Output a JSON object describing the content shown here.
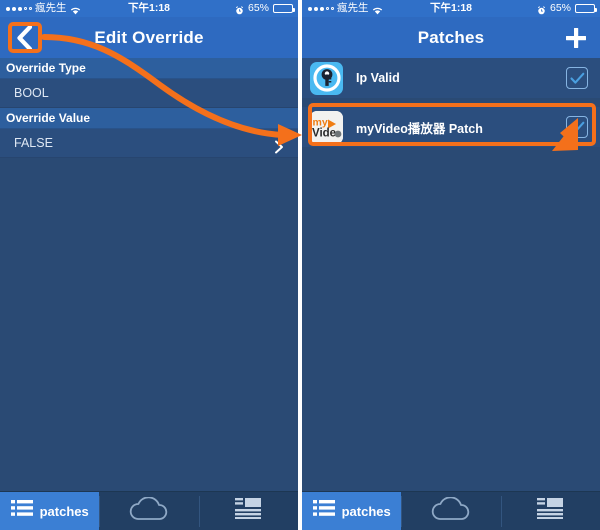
{
  "colors": {
    "navbar": "#2e6ac0",
    "statusbar": "#3070c8",
    "section_header": "#2d5f9e",
    "row": "#2b4e7e",
    "page_bg": "#2a4a74",
    "tabbar": "#223f63",
    "tab_active": "#3b7fd4",
    "annotation": "#f4701b",
    "checkbox_border": "#86b4e2",
    "checkbox_check": "#4a9fe0"
  },
  "status_bar": {
    "signal_filled": 3,
    "signal_empty": 2,
    "carrier": "瘋先生",
    "wifi_icon": "wifi-icon",
    "time": "下午1:18",
    "alarm_icon": "alarm-clock-icon",
    "battery_percent": "65%",
    "battery_level": 65
  },
  "left_screen": {
    "nav": {
      "back_icon": "chevron-left-icon",
      "title": "Edit Override"
    },
    "sections": [
      {
        "header": "Override Type",
        "value": "BOOL",
        "has_chevron": false
      },
      {
        "header": "Override Value",
        "value": "FALSE",
        "has_chevron": true,
        "chevron_icon": "chevron-right-icon"
      }
    ]
  },
  "right_screen": {
    "nav": {
      "title": "Patches",
      "add_icon": "plus-icon"
    },
    "patches": [
      {
        "icon": "key-lock-app-icon",
        "icon_text": "",
        "label": "Ip Valid",
        "checked": true,
        "highlighted": false
      },
      {
        "icon": "myvideo-app-icon",
        "icon_text_top": "my",
        "icon_text_bottom": "Video",
        "label": "myVideo播放器 Patch",
        "checked": true,
        "highlighted": true
      }
    ]
  },
  "tab_bar": {
    "tabs": [
      {
        "icon": "list-lines-icon",
        "label": "patches",
        "active": true
      },
      {
        "icon": "cloud-icon",
        "label": "",
        "active": false
      },
      {
        "icon": "news-article-icon",
        "label": "",
        "active": false
      }
    ]
  },
  "annotations": {
    "back_button_highlight": "rounded-rect-orange",
    "patch_row_highlight": "rounded-rect-orange",
    "curved_arrow": "curved-arrow-orange",
    "checkbox_pointer": "arrow-up-left-orange"
  }
}
